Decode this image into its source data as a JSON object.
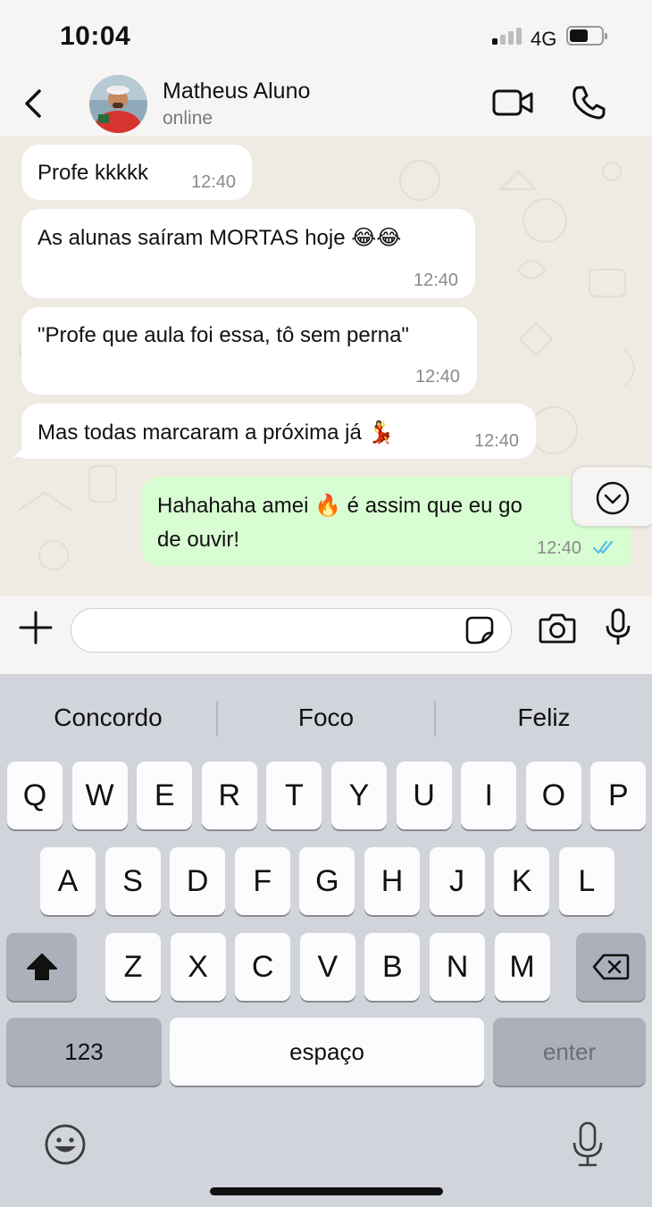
{
  "status_bar": {
    "time": "10:04",
    "network": "4G"
  },
  "header": {
    "contact_name": "Matheus Aluno",
    "contact_status": "online"
  },
  "messages": [
    {
      "direction": "incoming",
      "text": "Profe kkkkk",
      "time": "12:40"
    },
    {
      "direction": "incoming",
      "text": "As alunas saíram MORTAS hoje 😂😂",
      "time": "12:40"
    },
    {
      "direction": "incoming",
      "text": "\"Profe que aula foi essa, tô sem perna\"",
      "time": "12:40"
    },
    {
      "direction": "incoming",
      "text": "Mas todas marcaram a próxima já 💃",
      "time": "12:40"
    },
    {
      "direction": "outgoing",
      "text_line1": "Hahahaha amei 🔥 é assim que eu go",
      "text_line2": "de ouvir!",
      "time": "12:40",
      "status": "read"
    }
  ],
  "composer": {
    "placeholder": ""
  },
  "keyboard": {
    "suggestions": [
      "Concordo",
      "Foco",
      "Feliz"
    ],
    "row1": [
      "Q",
      "W",
      "E",
      "R",
      "T",
      "Y",
      "U",
      "I",
      "O",
      "P"
    ],
    "row2": [
      "A",
      "S",
      "D",
      "F",
      "G",
      "H",
      "J",
      "K",
      "L"
    ],
    "row3": [
      "Z",
      "X",
      "C",
      "V",
      "B",
      "N",
      "M"
    ],
    "numbers_label": "123",
    "space_label": "espaço",
    "enter_label": "enter"
  },
  "colors": {
    "incoming_bubble": "#ffffff",
    "outgoing_bubble": "#d9fdd3",
    "read_ticks": "#53bdeb",
    "chat_background": "#efeae2"
  },
  "icons": [
    "back-chevron-icon",
    "video-call-icon",
    "phone-icon",
    "chevron-down-icon",
    "plus-icon",
    "sticker-icon",
    "camera-icon",
    "microphone-icon",
    "shift-icon",
    "backspace-icon",
    "emoji-icon",
    "dictation-icon"
  ]
}
